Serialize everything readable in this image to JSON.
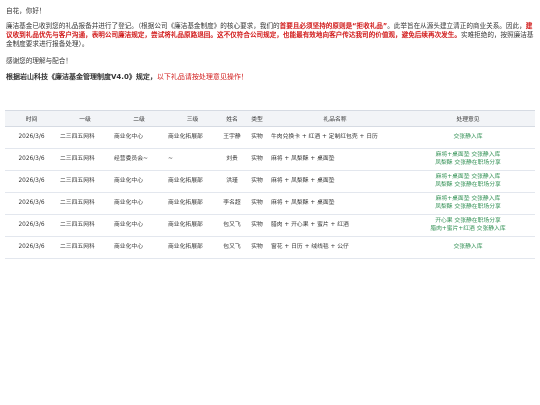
{
  "letter": {
    "greeting": "自花，你好！",
    "body_intro": "廉洁基金已收到您的礼品报备并进行了登记。（根据公司《廉洁基金制度》的核心要求，我们的",
    "body_red1": "首要且必须坚持的原则是“拒收礼品”",
    "body_mid": "。此举旨在从源头建立清正的商业关系。因此，",
    "body_red2": "建议收到礼品优先与客户沟通，表明公司廉洁规定，尝试将礼品原路退回。这不仅符合公司规定，也能最有效地向客户传达我司的价值观，避免后续再次发生。",
    "body_tail": "实难拒绝的，按照廉洁基金制度要求进行报备处理）。",
    "thanks": "感谢您的理解与配合！",
    "rule_bold": "根据岩山科技《廉洁基金管理制度V4.0》规定，",
    "rule_red": "以下礼品请按处理意见操作！"
  },
  "table": {
    "headers": [
      "时间",
      "一级",
      "二级",
      "三级",
      "姓名",
      "类型",
      "礼品名称",
      "处理意见"
    ],
    "rows": [
      {
        "date": "2026/3/6",
        "l1": "二三四五网科",
        "l2": "商业化中心",
        "l3": "商业化拓展部",
        "name": "王宇静",
        "type": "实物",
        "gift": "牛肉兑换卡 + 红酒 + 定制红包壳 + 日历",
        "advice": [
          "交张静入库"
        ]
      },
      {
        "date": "2026/3/6",
        "l1": "二三四五网科",
        "l2": "经营委员会~",
        "l3": "~",
        "name": "刘贵",
        "type": "实物",
        "gift": "麻将 + 凤梨酥 + 桌面垫",
        "advice": [
          "麻将+桌面垫 交张静入库",
          "凤梨酥 交张静在职场分享"
        ]
      },
      {
        "date": "2026/3/6",
        "l1": "二三四五网科",
        "l2": "商业化中心",
        "l3": "商业化拓展部",
        "name": "洪瑾",
        "type": "实物",
        "gift": "麻将 + 凤梨酥 + 桌面垫",
        "advice": [
          "麻将+桌面垫 交张静入库",
          "凤梨酥 交张静在职场分享"
        ]
      },
      {
        "date": "2026/3/6",
        "l1": "二三四五网科",
        "l2": "商业化中心",
        "l3": "商业化拓展部",
        "name": "李名超",
        "type": "实物",
        "gift": "麻将 + 凤梨酥 + 桌面垫",
        "advice": [
          "麻将+桌面垫 交张静入库",
          "凤梨酥 交张静在职场分享"
        ]
      },
      {
        "date": "2026/3/6",
        "l1": "二三四五网科",
        "l2": "商业化中心",
        "l3": "商业化拓展部",
        "name": "包又飞",
        "type": "实物",
        "gift": "腊肉 + 开心果 + 蜜片 + 红酒",
        "advice": [
          "开心果 交张静在职场分享",
          "腊肉+蜜片+红酒 交张静入库"
        ]
      },
      {
        "date": "2026/3/6",
        "l1": "二三四五网科",
        "l2": "商业化中心",
        "l3": "商业化拓展部",
        "name": "包又飞",
        "type": "实物",
        "gift": "窗花 + 日历 + 绒线毯 + 公仔",
        "advice": [
          "交张静入库"
        ]
      }
    ]
  }
}
